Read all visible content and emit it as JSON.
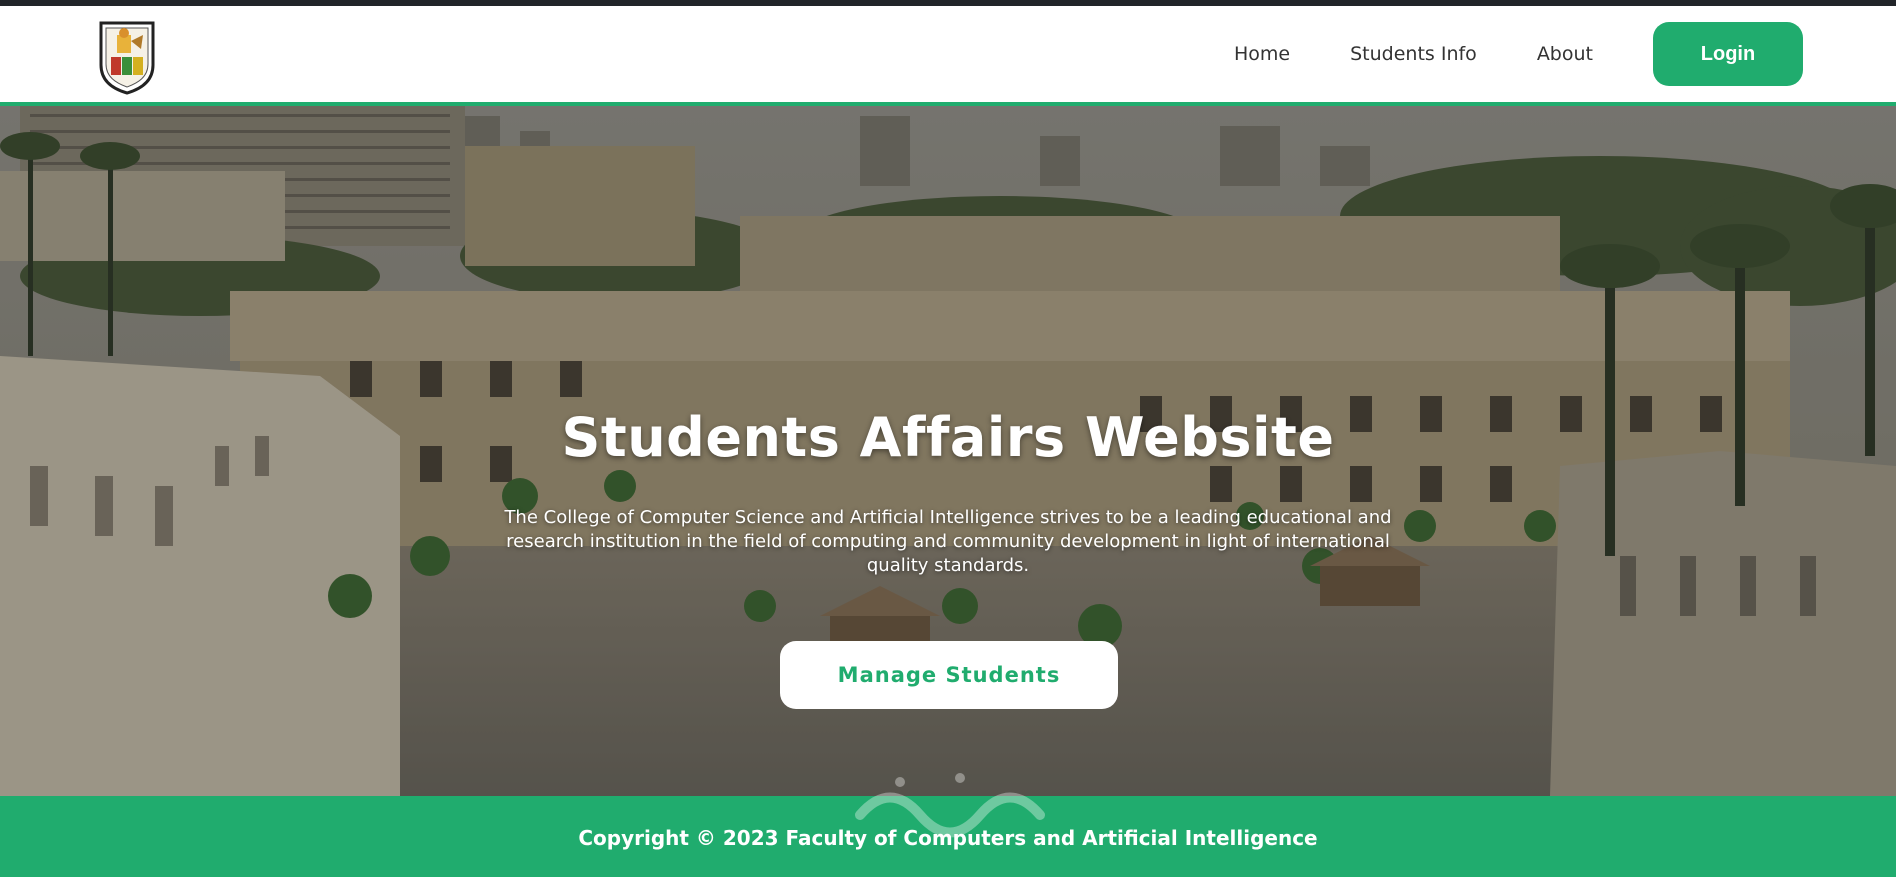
{
  "header": {
    "logo_icon": "university-crest-icon",
    "nav": [
      {
        "label": "Home"
      },
      {
        "label": "Students Info"
      },
      {
        "label": "About"
      }
    ],
    "login_label": "Login"
  },
  "hero": {
    "title": "Students Affairs Website",
    "description": "The College of Computer Science and Artificial Intelligence strives to be a leading educational and research institution in the field of computing and community development in light of international quality standards.",
    "cta_label": "Manage Students"
  },
  "footer": {
    "copyright": "Copyright © 2023 Faculty of Computers and Artificial Intelligence"
  },
  "colors": {
    "accent": "#20ac6e",
    "top_strip": "#212529",
    "nav_text": "#333333"
  }
}
